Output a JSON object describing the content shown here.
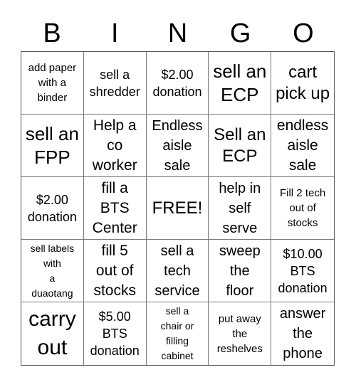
{
  "header": {
    "letters": [
      "B",
      "I",
      "N",
      "G",
      "O"
    ]
  },
  "cells": [
    "add paper\nwith a\nbinder",
    "sell a\nshredder",
    "$2.00\ndonation",
    "sell an\nECP",
    "cart\npick up",
    "sell an\nFPP",
    "Help a\nco\nworker",
    "Endless\naisle\nsale",
    "Sell an\nECP",
    "endless\naisle\nsale",
    "$2.00\ndonation",
    "fill a\nBTS\nCenter",
    "FREE!",
    "help in\nself\nserve",
    "Fill 2 tech\nout of\nstocks",
    "sell labels\nwith\na\nduaotang",
    "fill 5\nout of\nstocks",
    "sell a\ntech\nservice",
    "sweep\nthe\nfloor",
    "$10.00\nBTS\ndonation",
    "carry\nout",
    "$5.00\nBTS\ndonation",
    "sell a\nchair or\nfilling\ncabinet",
    "put away\nthe\nreshelves",
    "answer\nthe\nphone"
  ]
}
